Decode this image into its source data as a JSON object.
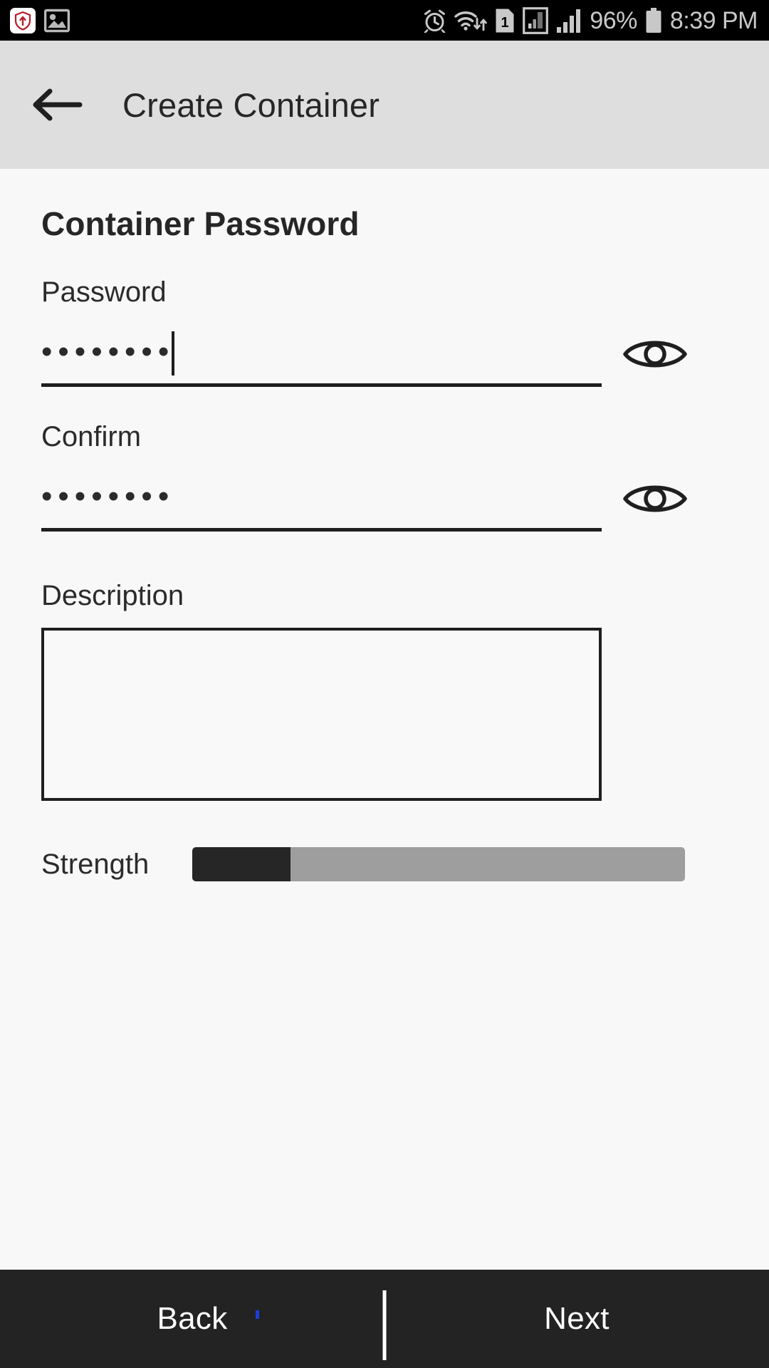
{
  "status_bar": {
    "left_icons": [
      {
        "name": "notification-shield-icon",
        "glyph": "shield-up"
      },
      {
        "name": "image-notification-icon",
        "glyph": "photo"
      }
    ],
    "right_icons": [
      {
        "name": "alarm-clock-icon",
        "glyph": "alarm"
      },
      {
        "name": "wifi-transfer-icon",
        "glyph": "wifi"
      },
      {
        "name": "sim-card-1-icon",
        "glyph": "sim",
        "label": "1"
      },
      {
        "name": "signal-boxed-icon",
        "glyph": "signal-box"
      },
      {
        "name": "signal-bars-icon",
        "glyph": "signal"
      }
    ],
    "battery_percent": "96%",
    "battery_icon": "battery-full-icon",
    "time": "8:39 PM"
  },
  "app_bar": {
    "back_icon": "arrow-left-icon",
    "title": "Create Container",
    "background": "#dedede"
  },
  "content": {
    "section_title": "Container Password",
    "password": {
      "label": "Password",
      "value": "••••••••",
      "masked_char_count": 8,
      "placeholder": "",
      "has_caret": true,
      "toggle_icon": "eye-icon"
    },
    "confirm": {
      "label": "Confirm",
      "value": "••••••••",
      "masked_char_count": 8,
      "placeholder": "",
      "has_caret": false,
      "toggle_icon": "eye-icon"
    },
    "description": {
      "label": "Description",
      "value": "",
      "placeholder": ""
    },
    "strength": {
      "label": "Strength",
      "percent": 20,
      "fill_color": "#262626",
      "track_color": "#9e9e9e"
    }
  },
  "bottom_bar": {
    "back_label": "Back",
    "next_label": "Next",
    "background": "#232323"
  }
}
